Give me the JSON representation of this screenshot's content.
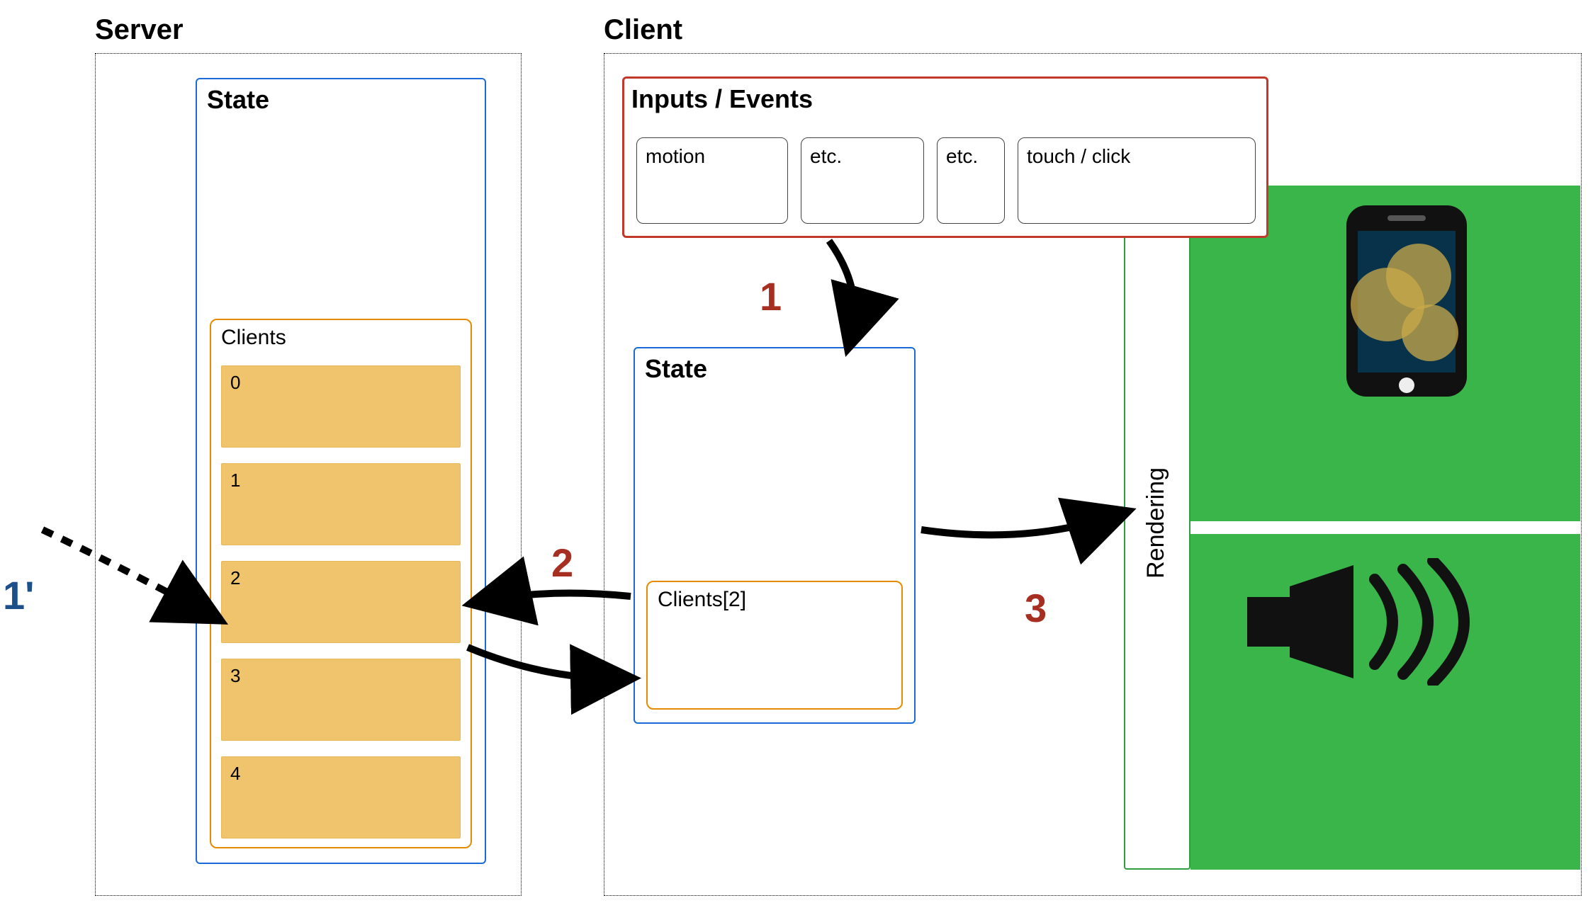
{
  "server": {
    "label": "Server",
    "state": {
      "title": "State",
      "clients": {
        "title": "Clients",
        "rows": [
          "0",
          "1",
          "2",
          "3",
          "4"
        ]
      }
    }
  },
  "client": {
    "label": "Client",
    "inputs": {
      "title": "Inputs / Events",
      "items": [
        "motion",
        "etc.",
        "etc.",
        "touch / click"
      ]
    },
    "state": {
      "title": "State",
      "clients2_label": "Clients[2]"
    },
    "rendering_label": "Rendering"
  },
  "steps": {
    "one": "1",
    "one_prime": "1'",
    "two": "2",
    "three": "3"
  },
  "icons": {
    "phone": "phone-icon",
    "speaker": "speaker-icon"
  },
  "colors": {
    "blue": "#1a6bd8",
    "orange": "#e68a00",
    "orange_fill": "#f0c36d",
    "red": "#c0392b",
    "green_border": "#2e9e3f",
    "green_fill": "#39b54a",
    "step_red": "#a72f22",
    "step_blue": "#1d4f8b"
  }
}
